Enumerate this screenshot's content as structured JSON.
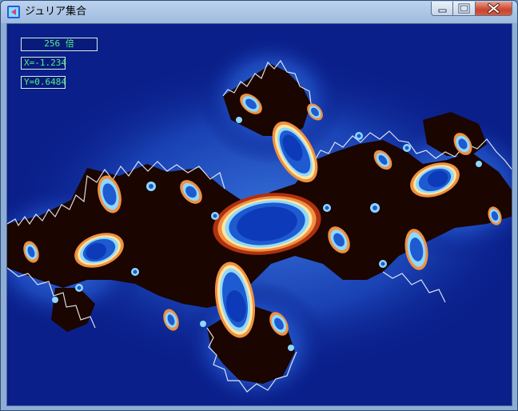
{
  "window": {
    "title": "ジュリア集合",
    "controls": {
      "minimize": "minimize",
      "maximize": "maximize",
      "close": "close"
    }
  },
  "hud": {
    "zoom": "256 倍",
    "x": "X=-1.234",
    "y": "Y=0.6484"
  },
  "colors": {
    "background": "#0a1f8a",
    "hud_text": "#52f08a",
    "fractal_interior": "#1a0500",
    "fractal_bands": [
      "#0d2a9c",
      "#1e5ad0",
      "#8fd8ff",
      "#ffffff",
      "#ffe6a0",
      "#f09040",
      "#b03010"
    ]
  },
  "icons": {
    "app": "julia-app-icon",
    "minimize": "minimize-icon",
    "maximize": "maximize-icon",
    "close": "close-icon"
  }
}
